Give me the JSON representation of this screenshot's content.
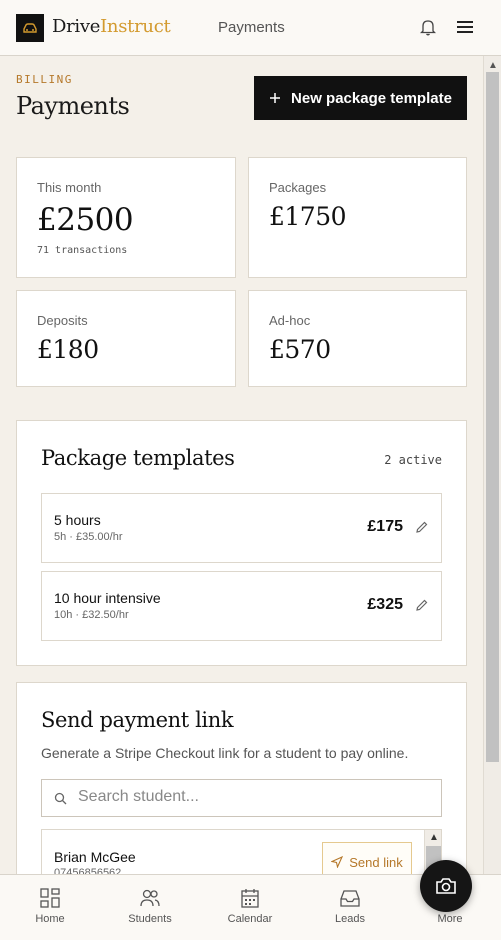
{
  "app": {
    "brand_part1": "Drive",
    "brand_part2": "Instruct",
    "nav_current": "Payments"
  },
  "page": {
    "eyebrow": "BILLING",
    "title": "Payments",
    "new_button_label": "New package template"
  },
  "stats": [
    {
      "label": "This month",
      "value": "£2500",
      "sub": "71 transactions"
    },
    {
      "label": "Packages",
      "value": "£1750"
    },
    {
      "label": "Deposits",
      "value": "£180"
    },
    {
      "label": "Ad-hoc",
      "value": "£570"
    }
  ],
  "templates": {
    "title": "Package templates",
    "active_count": "2 active",
    "items": [
      {
        "name": "5 hours",
        "meta": "5h · £35.00/hr",
        "price": "£175"
      },
      {
        "name": "10 hour intensive",
        "meta": "10h · £32.50/hr",
        "price": "£325"
      }
    ]
  },
  "payment_link": {
    "title": "Send payment link",
    "description": "Generate a Stripe Checkout link for a student to pay online.",
    "search_placeholder": "Search student...",
    "students": [
      {
        "name": "Brian McGee",
        "phone": "07456856562",
        "action": "Send link"
      }
    ]
  },
  "bottom_nav": [
    {
      "label": "Home",
      "icon": "grid-icon"
    },
    {
      "label": "Students",
      "icon": "users-icon"
    },
    {
      "label": "Calendar",
      "icon": "calendar-icon"
    },
    {
      "label": "Leads",
      "icon": "inbox-icon"
    },
    {
      "label": "More",
      "icon": "more-icon"
    }
  ],
  "colors": {
    "accent": "#d39a2e",
    "background": "#f4f0e9",
    "primary_button": "#111111"
  }
}
